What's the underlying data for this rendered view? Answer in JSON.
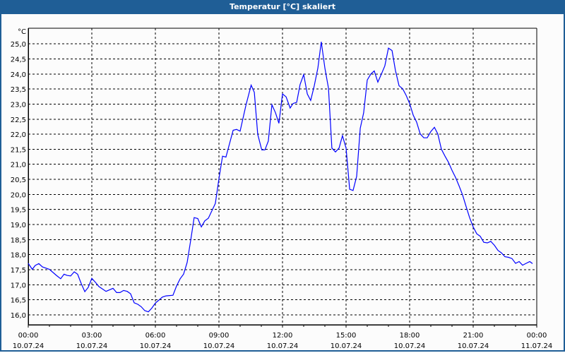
{
  "window": {
    "title": "Temperatur [°C] skaliert"
  },
  "colors": {
    "titlebar": "#1f5e96",
    "series": "#0000ff",
    "grid": "#000000"
  },
  "chart_data": {
    "type": "line",
    "title": "Temperatur [°C] skaliert",
    "ylabel": "°C",
    "xlabel": "",
    "xlim": [
      0,
      24
    ],
    "ylim": [
      15.67,
      25.52
    ],
    "grid": true,
    "y_ticks": [
      16.0,
      16.5,
      17.0,
      17.5,
      18.0,
      18.5,
      19.0,
      19.5,
      20.0,
      20.5,
      21.0,
      21.5,
      22.0,
      22.5,
      23.0,
      23.5,
      24.0,
      24.5,
      25.0
    ],
    "y_tick_labels": [
      "16,0",
      "16,5",
      "17,0",
      "17,5",
      "18,0",
      "18,5",
      "19,0",
      "19,5",
      "20,0",
      "20,5",
      "21,0",
      "21,5",
      "22,0",
      "22,5",
      "23,0",
      "23,5",
      "24,0",
      "24,5",
      "25,0"
    ],
    "x_ticks": [
      0,
      3,
      6,
      9,
      12,
      15,
      18,
      21,
      24
    ],
    "x_tick_labels": [
      {
        "time": "00:00",
        "date": "10.07.24"
      },
      {
        "time": "03:00",
        "date": "10.07.24"
      },
      {
        "time": "06:00",
        "date": "10.07.24"
      },
      {
        "time": "09:00",
        "date": "10.07.24"
      },
      {
        "time": "12:00",
        "date": "10.07.24"
      },
      {
        "time": "15:00",
        "date": "10.07.24"
      },
      {
        "time": "18:00",
        "date": "10.07.24"
      },
      {
        "time": "21:00",
        "date": "10.07.24"
      },
      {
        "time": "00:00",
        "date": "11.07.24"
      }
    ],
    "series": [
      {
        "name": "Temperatur",
        "points": [
          [
            0,
            17.71
          ],
          [
            0.19,
            17.51
          ],
          [
            0.33,
            17.64
          ],
          [
            0.5,
            17.7
          ],
          [
            0.67,
            17.59
          ],
          [
            1.0,
            17.51
          ],
          [
            1.33,
            17.31
          ],
          [
            1.53,
            17.2
          ],
          [
            1.69,
            17.35
          ],
          [
            1.83,
            17.31
          ],
          [
            2.0,
            17.29
          ],
          [
            2.17,
            17.43
          ],
          [
            2.33,
            17.35
          ],
          [
            2.5,
            17.04
          ],
          [
            2.67,
            16.77
          ],
          [
            2.83,
            16.91
          ],
          [
            3.0,
            17.21
          ],
          [
            3.17,
            17.08
          ],
          [
            3.33,
            16.94
          ],
          [
            3.67,
            16.78
          ],
          [
            4.0,
            16.88
          ],
          [
            4.17,
            16.74
          ],
          [
            4.33,
            16.74
          ],
          [
            4.5,
            16.81
          ],
          [
            4.67,
            16.78
          ],
          [
            4.83,
            16.7
          ],
          [
            5.0,
            16.4
          ],
          [
            5.17,
            16.35
          ],
          [
            5.33,
            16.27
          ],
          [
            5.5,
            16.14
          ],
          [
            5.67,
            16.1
          ],
          [
            5.83,
            16.22
          ],
          [
            6.0,
            16.39
          ],
          [
            6.17,
            16.49
          ],
          [
            6.33,
            16.59
          ],
          [
            6.5,
            16.63
          ],
          [
            6.83,
            16.65
          ],
          [
            7.0,
            16.96
          ],
          [
            7.17,
            17.2
          ],
          [
            7.33,
            17.35
          ],
          [
            7.5,
            17.74
          ],
          [
            7.67,
            18.49
          ],
          [
            7.83,
            19.23
          ],
          [
            8.0,
            19.2
          ],
          [
            8.17,
            18.92
          ],
          [
            8.33,
            19.12
          ],
          [
            8.5,
            19.21
          ],
          [
            8.83,
            19.7
          ],
          [
            9.0,
            20.52
          ],
          [
            9.17,
            21.27
          ],
          [
            9.33,
            21.24
          ],
          [
            9.67,
            22.13
          ],
          [
            9.83,
            22.16
          ],
          [
            10.0,
            22.1
          ],
          [
            10.28,
            22.98
          ],
          [
            10.52,
            23.63
          ],
          [
            10.67,
            23.39
          ],
          [
            10.83,
            22.0
          ],
          [
            11.02,
            21.48
          ],
          [
            11.17,
            21.48
          ],
          [
            11.33,
            21.77
          ],
          [
            11.5,
            22.98
          ],
          [
            11.67,
            22.71
          ],
          [
            11.83,
            22.36
          ],
          [
            12.0,
            23.34
          ],
          [
            12.17,
            23.24
          ],
          [
            12.36,
            22.87
          ],
          [
            12.5,
            23.02
          ],
          [
            12.67,
            23.06
          ],
          [
            12.83,
            23.65
          ],
          [
            13.0,
            23.98
          ],
          [
            13.17,
            23.34
          ],
          [
            13.33,
            23.12
          ],
          [
            13.5,
            23.61
          ],
          [
            13.67,
            24.2
          ],
          [
            13.83,
            25.07
          ],
          [
            14.0,
            24.2
          ],
          [
            14.17,
            23.53
          ],
          [
            14.33,
            21.54
          ],
          [
            14.5,
            21.41
          ],
          [
            14.67,
            21.54
          ],
          [
            14.83,
            21.95
          ],
          [
            15.0,
            21.54
          ],
          [
            15.17,
            20.17
          ],
          [
            15.33,
            20.13
          ],
          [
            15.5,
            20.6
          ],
          [
            15.67,
            22.2
          ],
          [
            15.83,
            22.71
          ],
          [
            16.0,
            23.8
          ],
          [
            16.17,
            24.0
          ],
          [
            16.33,
            24.1
          ],
          [
            16.5,
            23.73
          ],
          [
            16.67,
            24.0
          ],
          [
            16.83,
            24.27
          ],
          [
            17.0,
            24.86
          ],
          [
            17.17,
            24.78
          ],
          [
            17.33,
            24.12
          ],
          [
            17.5,
            23.61
          ],
          [
            17.67,
            23.51
          ],
          [
            17.83,
            23.3
          ],
          [
            18.0,
            23.02
          ],
          [
            18.17,
            22.63
          ],
          [
            18.33,
            22.4
          ],
          [
            18.5,
            22.01
          ],
          [
            18.67,
            21.88
          ],
          [
            18.83,
            21.88
          ],
          [
            19.0,
            22.09
          ],
          [
            19.17,
            22.23
          ],
          [
            19.33,
            22.01
          ],
          [
            19.5,
            21.5
          ],
          [
            19.67,
            21.27
          ],
          [
            19.83,
            21.07
          ],
          [
            20.0,
            20.8
          ],
          [
            20.17,
            20.56
          ],
          [
            20.33,
            20.29
          ],
          [
            20.5,
            19.98
          ],
          [
            20.67,
            19.59
          ],
          [
            20.83,
            19.23
          ],
          [
            21.0,
            18.92
          ],
          [
            21.17,
            18.69
          ],
          [
            21.33,
            18.61
          ],
          [
            21.5,
            18.41
          ],
          [
            21.67,
            18.39
          ],
          [
            21.83,
            18.44
          ],
          [
            22.0,
            18.31
          ],
          [
            22.17,
            18.14
          ],
          [
            22.33,
            18.06
          ],
          [
            22.5,
            17.93
          ],
          [
            22.67,
            17.91
          ],
          [
            22.83,
            17.87
          ],
          [
            23.0,
            17.71
          ],
          [
            23.17,
            17.77
          ],
          [
            23.33,
            17.65
          ],
          [
            23.5,
            17.71
          ],
          [
            23.67,
            17.77
          ],
          [
            23.8,
            17.7
          ]
        ]
      }
    ]
  }
}
